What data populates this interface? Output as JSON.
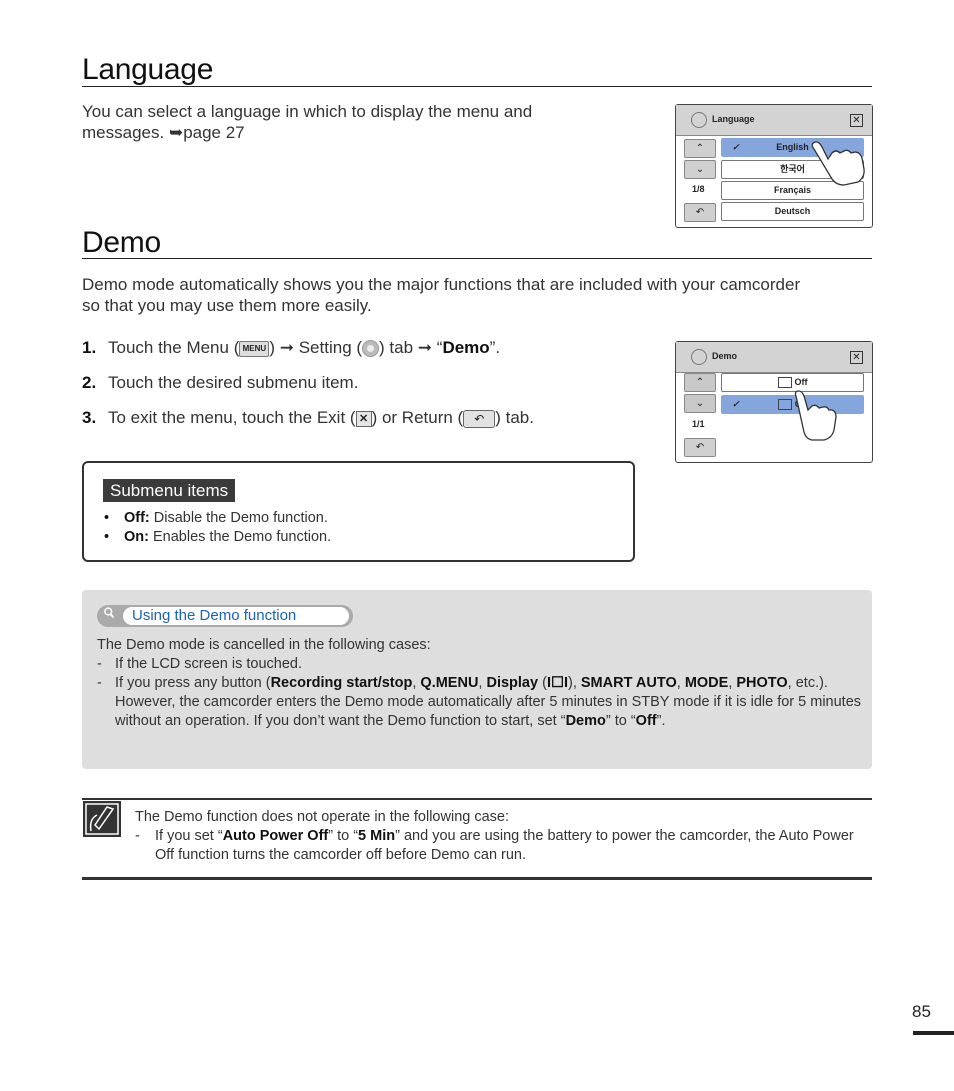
{
  "language_section": {
    "title": "Language",
    "intro_line1": "You can select a language in which to display the menu and",
    "intro_line2_text": "messages.",
    "page_ref_arrow": "➥",
    "page_ref": "page 27",
    "lcd": {
      "title": "Language",
      "page_indicator": "1/8",
      "items": [
        {
          "label": "English",
          "selected": true
        },
        {
          "label": "한국어",
          "selected": false
        },
        {
          "label": "Français",
          "selected": false
        },
        {
          "label": "Deutsch",
          "selected": false
        }
      ],
      "up_icon": "⌃",
      "down_icon": "⌄",
      "return_icon": "↶",
      "close_icon": "✕",
      "check_icon": "✓"
    }
  },
  "demo_section": {
    "title": "Demo",
    "intro_line1": "Demo mode automatically shows you the major functions that are included with your camcorder",
    "intro_line2": "so that you may use them more easily.",
    "steps": [
      {
        "num": "1.",
        "parts": {
          "a": "Touch the Menu (",
          "menu_icon": "MENU",
          "b": ") ",
          "arrow1": "➞",
          "c": " Setting (",
          "d": ") tab ",
          "arrow2": "➞",
          "e": " “",
          "bold": "Demo",
          "f": "”."
        }
      },
      {
        "num": "2.",
        "text": "Touch the desired submenu item."
      },
      {
        "num": "3.",
        "parts": {
          "a": "To exit the menu, touch the Exit (",
          "exit_icon": "✕",
          "b": ") or Return (",
          "return_icon": "↶",
          "c": ") tab."
        }
      }
    ],
    "lcd": {
      "title": "Demo",
      "page_indicator": "1/1",
      "items": [
        {
          "label": "Off",
          "selected": false
        },
        {
          "label": "On",
          "selected": true
        }
      ],
      "up_icon": "⌃",
      "down_icon": "⌄",
      "return_icon": "↶",
      "close_icon": "✕",
      "check_icon": "✓"
    },
    "submenu": {
      "title": "Submenu items",
      "items": [
        {
          "term": "Off:",
          "desc": " Disable the Demo function."
        },
        {
          "term": "On:",
          "desc": " Enables the Demo function."
        }
      ]
    }
  },
  "tip": {
    "title": "Using the Demo function",
    "intro": "The Demo mode is cancelled in the following cases:",
    "dash": "-",
    "case1": "If the LCD screen is touched.",
    "case2": {
      "a": "If you press any button (",
      "b1": "Recording start/stop",
      "s1": ", ",
      "b2": "Q.MENU",
      "s2": ", ",
      "b3": "Display",
      "s3": " (",
      "b4": "I☐I",
      "s4": "), ",
      "b5": "SMART AUTO",
      "s5": ", ",
      "b6": "MODE",
      "s6": ", ",
      "b7": "PHOTO",
      "s7": ", etc.). However, the camcorder enters the Demo mode automatically after 5 minutes in STBY mode if it is idle for 5 minutes without an operation. If you don’t want the Demo function to start, set “",
      "b8": "Demo",
      "s8": "” to “",
      "b9": "Off",
      "s9": "”."
    }
  },
  "note": {
    "intro": "The Demo function does not operate in the following case:",
    "dash": "-",
    "a": "If you set “",
    "b1": "Auto Power Off",
    "s1": "” to “",
    "b2": "5 Min",
    "s2": "” and you are using the battery to power the camcorder, the Auto Power Off function turns the camcorder off before Demo can run."
  },
  "page_number": "85",
  "colors": {
    "lcd_selected": "#84a6dc",
    "tip_title": "#1a63b5",
    "tip_background": "#dedede",
    "submenu_title_bg": "#3b3b3b"
  }
}
